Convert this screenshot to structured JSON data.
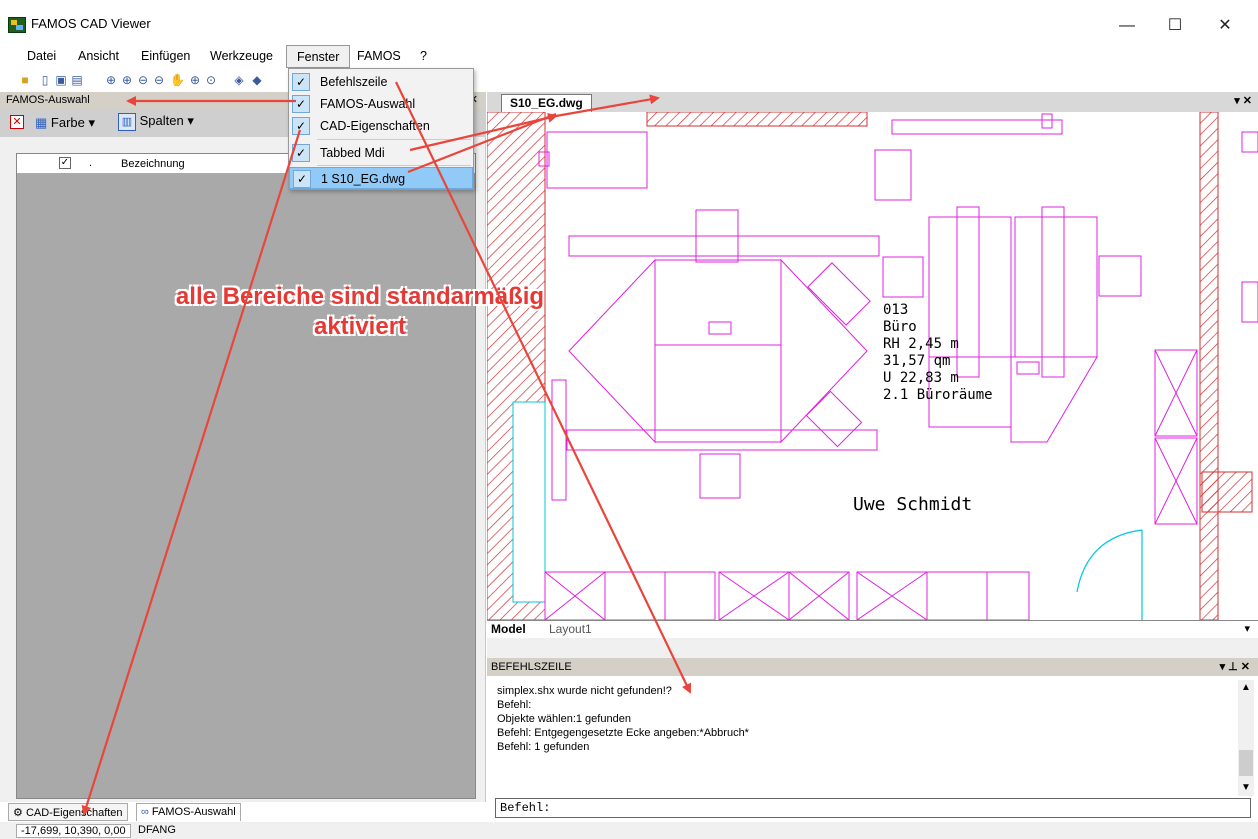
{
  "window": {
    "title": "FAMOS CAD Viewer",
    "minimize": "—",
    "maximize": "☐",
    "close": "✕"
  },
  "menubar": [
    "Datei",
    "Ansicht",
    "Einfügen",
    "Werkzeuge",
    "Fenster",
    "FAMOS",
    "?"
  ],
  "fenster_menu": {
    "items": [
      "Befehlszeile",
      "FAMOS-Auswahl",
      "CAD-Eigenschaften",
      "Tabbed Mdi",
      "1 S10_EG.dwg"
    ]
  },
  "left_panel": {
    "title": "FAMOS-Auswahl",
    "toolbar": {
      "farbe": "Farbe",
      "spalten": "Spalten"
    },
    "column_dot": ".",
    "column_header": "Bezeichnung"
  },
  "bottom_tabs": [
    "CAD-Eigenschaften",
    "FAMOS-Auswahl"
  ],
  "status": {
    "coords": "-17,699, 10,390, 0,00",
    "mode": "DFANG"
  },
  "doc": {
    "tab": "S10_EG.dwg",
    "layout_tabs": [
      "Model",
      "Layout1"
    ],
    "room_label": [
      "013",
      "Büro",
      "RH 2,45 m",
      "31,57 qm",
      "U 22,83 m",
      "2.1 Büroräume"
    ],
    "person": "Uwe Schmidt"
  },
  "command": {
    "title": "BEFEHLSZEILE",
    "log": [
      "simplex.shx wurde nicht gefunden!?",
      "Befehl:",
      "Objekte wählen:1 gefunden",
      "Befehl:  Entgegengesetzte Ecke angeben:*Abbruch*",
      "Befehl: 1 gefunden"
    ],
    "input_label": "Befehl:"
  },
  "annotation": {
    "line1": "alle Bereiche sind standarmäßig",
    "line2": "aktiviert"
  },
  "colors": {
    "cad": "#e020e0",
    "hatch": "#d03030",
    "door": "#00c8d8",
    "arrow": "#e8463c"
  }
}
